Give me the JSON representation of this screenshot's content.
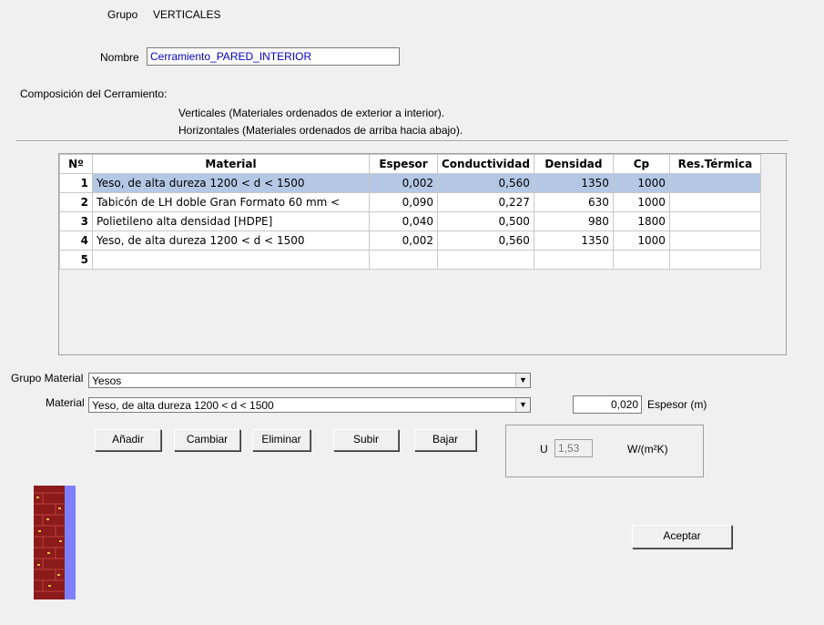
{
  "grupo": {
    "label": "Grupo",
    "value": "VERTICALES"
  },
  "nombre": {
    "label": "Nombre",
    "value": "Cerramiento_PARED_INTERIOR"
  },
  "composicion": {
    "title": "Composición del Cerramiento:",
    "line1": "Verticales (Materiales ordenados de exterior a interior).",
    "line2": "Horizontales (Materiales ordenados de arriba hacia abajo)."
  },
  "table": {
    "headers": [
      "Nº",
      "Material",
      "Espesor",
      "Conductividad",
      "Densidad",
      "Cp",
      "Res.Térmica"
    ],
    "rows": [
      {
        "n": "1",
        "material": "Yeso, de alta dureza 1200 < d < 1500",
        "espesor": "0,002",
        "conductividad": "0,560",
        "densidad": "1350",
        "cp": "1000",
        "res": "",
        "selected": true
      },
      {
        "n": "2",
        "material": "Tabicón de LH doble Gran Formato 60 mm <",
        "espesor": "0,090",
        "conductividad": "0,227",
        "densidad": "630",
        "cp": "1000",
        "res": ""
      },
      {
        "n": "3",
        "material": "Polietileno alta densidad [HDPE]",
        "espesor": "0,040",
        "conductividad": "0,500",
        "densidad": "980",
        "cp": "1800",
        "res": ""
      },
      {
        "n": "4",
        "material": "Yeso, de alta dureza 1200 < d < 1500",
        "espesor": "0,002",
        "conductividad": "0,560",
        "densidad": "1350",
        "cp": "1000",
        "res": ""
      },
      {
        "n": "5",
        "material": "",
        "espesor": "",
        "conductividad": "",
        "densidad": "",
        "cp": "",
        "res": ""
      }
    ]
  },
  "grupo_material": {
    "label": "Grupo Material",
    "value": "Yesos"
  },
  "material": {
    "label": "Material",
    "value": "Yeso, de alta dureza 1200 < d < 1500"
  },
  "espesor": {
    "value": "0,020",
    "label": "Espesor (m)"
  },
  "buttons": {
    "anadir": "Añadir",
    "cambiar": "Cambiar",
    "eliminar": "Eliminar",
    "subir": "Subir",
    "bajar": "Bajar",
    "aceptar": "Aceptar"
  },
  "u": {
    "label": "U",
    "value": "1,53",
    "unit": "W/(m²K)"
  },
  "icons": {
    "combo_arrow": "dropdown-arrow-icon",
    "preview": "wall-preview-icon"
  },
  "colors": {
    "selection": "#b4c8e6",
    "name_text": "#0000c8",
    "brick": "#8b1a1a",
    "plaster": "#8080ff"
  }
}
